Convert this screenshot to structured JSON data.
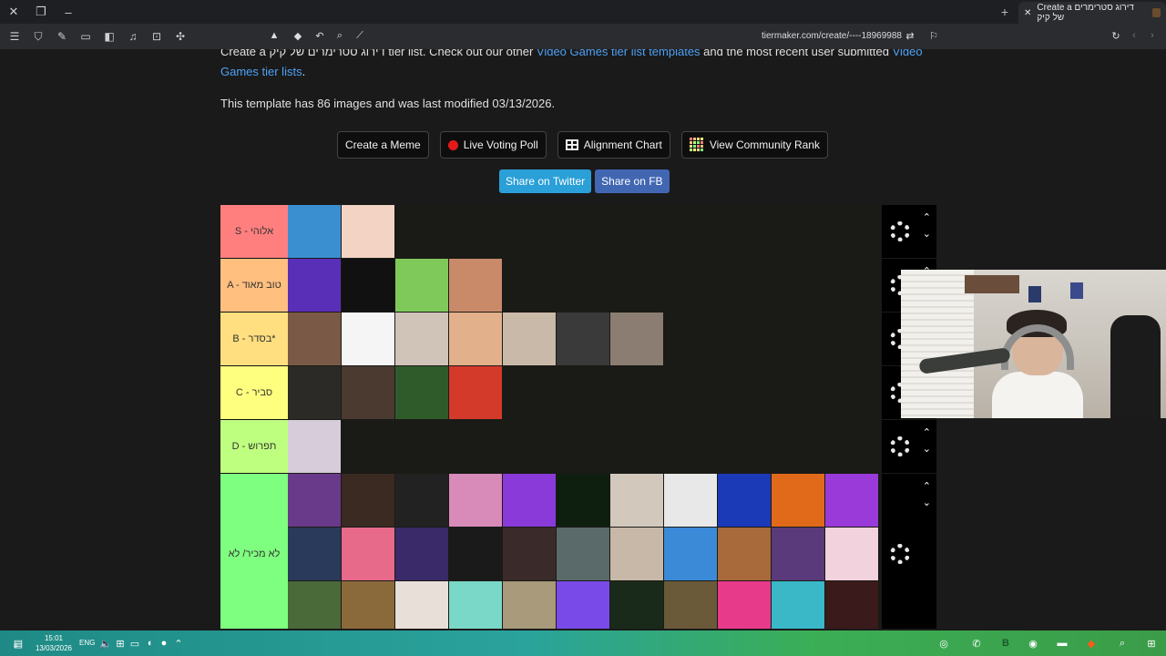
{
  "browser": {
    "tab_title": "Create a דירוג סטרימרים של קיק",
    "url": "tiermaker.com/create/----18969988"
  },
  "page": {
    "intro_pre": "Create a דירוג סטרימרים של קיק tier list. Check out our other ",
    "intro_link1": "Video Games tier list templates",
    "intro_mid": " and the most recent user submitted ",
    "intro_link2": "Video Games tier lists",
    "intro_end": ".",
    "meta": "This template has 86 images and was last modified 03/13/2026."
  },
  "actions": {
    "create_meme": "Create a Meme",
    "live_poll": "Live Voting Poll",
    "alignment": "Alignment Chart",
    "community_rank": "View Community Rank",
    "share_twitter": "Share on Twitter",
    "share_fb": "Share on FB"
  },
  "tiers": [
    {
      "label": "S - אלוהי",
      "color": "#ff7f7f",
      "tiles": [
        "#3a8fd1",
        "#f2d3c4"
      ]
    },
    {
      "label": "A - טוב מאוד",
      "color": "#ffbf7f",
      "tiles": [
        "#5a2fb8",
        "#111111",
        "#7fc95a",
        "#c98a6a"
      ]
    },
    {
      "label": "B - בסדר*",
      "color": "#ffdf7f",
      "tiles": [
        "#7a5a46",
        "#f5f5f5",
        "#d0c3b8",
        "#e2b08a",
        "#c9b9a8",
        "#3a3a3a",
        "#8b7d72"
      ]
    },
    {
      "label": "C - סביר",
      "color": "#ffff7f",
      "tiles": [
        "#2b2a26",
        "#4a3a30",
        "#2f5a2a",
        "#d43a2a"
      ]
    },
    {
      "label": "D - תפרוש",
      "color": "#bfff7f",
      "tiles": [
        "#d7ccd9"
      ]
    },
    {
      "label": "לא מכיר/ לא",
      "color": "#7fff7f",
      "tiles": [
        "#6a3a8a",
        "#3a2a22",
        "#222222",
        "#d88ab8",
        "#8a3ad8",
        "#0f1f0f",
        "#d2c8bc",
        "#e8e8e8",
        "#1a3ab8",
        "#e06a1a",
        "#9a3ad8",
        "#2a3a5a",
        "#e86a8a",
        "#3a2a6a",
        "#1a1a1a",
        "#3a2a2a",
        "#5a6a6a",
        "#c8b8a8",
        "#3a8ad8",
        "#a86a3a",
        "#5a3a7a",
        "#f2d2dc",
        "#4a6a3a",
        "#8a6a3a",
        "#e8e0d8",
        "#7ad8c8",
        "#a89a7a",
        "#7a4ae8",
        "#1a2a1a",
        "#6a5a3a",
        "#e83a8a",
        "#3ab8c8",
        "#3a1a1a"
      ]
    }
  ],
  "taskbar": {
    "time": "15:01",
    "date": "13/03/2026",
    "lang": "ENG",
    "notifications": "8"
  }
}
